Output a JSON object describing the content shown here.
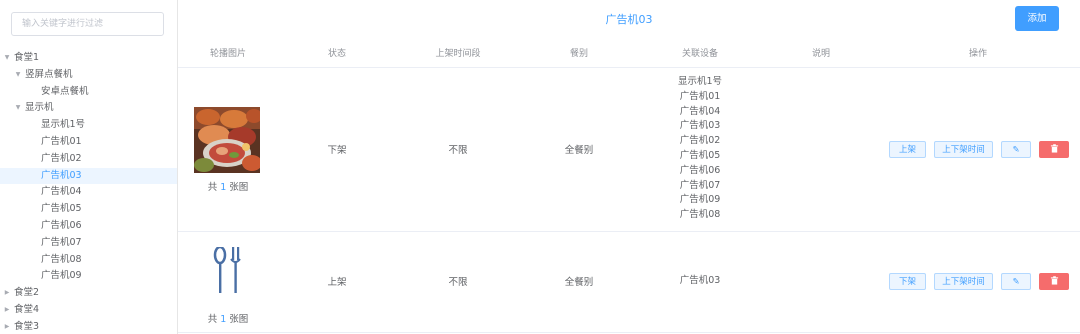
{
  "sidebar": {
    "search_placeholder": "输入关键字进行过滤",
    "tree": [
      {
        "label": "食堂1",
        "level": 0,
        "caret": "expanded"
      },
      {
        "label": "竖屏点餐机",
        "level": 1,
        "caret": "expanded"
      },
      {
        "label": "安卓点餐机",
        "level": 2,
        "caret": "none"
      },
      {
        "label": "显示机",
        "level": 1,
        "caret": "expanded"
      },
      {
        "label": "显示机1号",
        "level": 2,
        "caret": "none"
      },
      {
        "label": "广告机01",
        "level": 2,
        "caret": "none"
      },
      {
        "label": "广告机02",
        "level": 2,
        "caret": "none"
      },
      {
        "label": "广告机03",
        "level": 2,
        "caret": "none",
        "selected": true
      },
      {
        "label": "广告机04",
        "level": 2,
        "caret": "none"
      },
      {
        "label": "广告机05",
        "level": 2,
        "caret": "none"
      },
      {
        "label": "广告机06",
        "level": 2,
        "caret": "none"
      },
      {
        "label": "广告机07",
        "level": 2,
        "caret": "none"
      },
      {
        "label": "广告机08",
        "level": 2,
        "caret": "none"
      },
      {
        "label": "广告机09",
        "level": 2,
        "caret": "none"
      },
      {
        "label": "食堂2",
        "level": 0,
        "caret": "collapsed"
      },
      {
        "label": "食堂4",
        "level": 0,
        "caret": "collapsed"
      },
      {
        "label": "食堂3",
        "level": 0,
        "caret": "collapsed"
      }
    ]
  },
  "header": {
    "title": "广告机03",
    "add_label": "添加"
  },
  "table": {
    "columns": [
      "轮播图片",
      "状态",
      "上架时间段",
      "餐别",
      "关联设备",
      "说明",
      "操作"
    ],
    "rows": [
      {
        "image": "food-photo",
        "count_prefix": "共 ",
        "count": "1",
        "count_suffix": " 张图",
        "status": "下架",
        "time_range": "不限",
        "meal": "全餐别",
        "devices": [
          "显示机1号",
          "广告机01",
          "广告机04",
          "广告机03",
          "广告机02",
          "广告机05",
          "广告机06",
          "广告机07",
          "广告机09",
          "广告机08"
        ],
        "note": "",
        "toggle_label": "上架",
        "time_label": "上下架时间"
      },
      {
        "image": "spoon-fork-icon",
        "count_prefix": "共 ",
        "count": "1",
        "count_suffix": " 张图",
        "status": "上架",
        "time_range": "不限",
        "meal": "全餐别",
        "devices": [
          "广告机03"
        ],
        "note": "",
        "toggle_label": "下架",
        "time_label": "上下架时间"
      }
    ],
    "edit_icon": "edit-icon",
    "delete_icon": "trash-icon"
  },
  "colors": {
    "primary": "#409eff",
    "danger": "#f56c6c",
    "selected_bg": "#ecf5ff"
  }
}
